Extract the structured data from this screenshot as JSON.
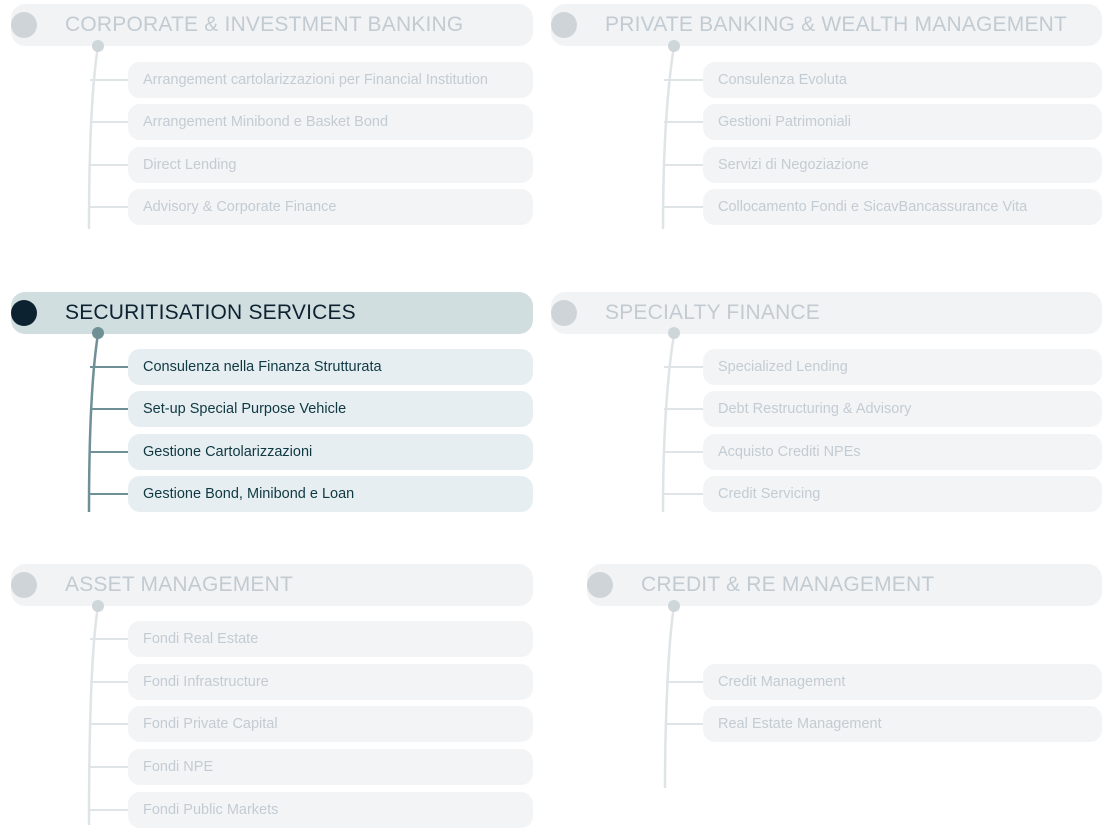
{
  "groups": [
    {
      "title": "CORPORATE & INVESTMENT BANKING",
      "active": false,
      "items": [
        "Arrangement cartolarizzazioni per Financial Institution",
        "Arrangement Minibond e Basket Bond",
        "Direct Lending",
        "Advisory & Corporate Finance"
      ]
    },
    {
      "title": "PRIVATE BANKING & WEALTH MANAGEMENT",
      "active": false,
      "items": [
        "Consulenza Evoluta",
        "Gestioni Patrimoniali",
        "Servizi di Negoziazione",
        "Collocamento Fondi e SicavBancassurance Vita"
      ]
    },
    {
      "title": "SECURITISATION SERVICES",
      "active": true,
      "items": [
        "Consulenza nella Finanza Strutturata",
        "Set-up Special Purpose Vehicle",
        "Gestione Cartolarizzazioni",
        "Gestione Bond, Minibond e Loan"
      ]
    },
    {
      "title": "SPECIALTY FINANCE",
      "active": false,
      "items": [
        "Specialized Lending",
        "Debt Restructuring & Advisory",
        "Acquisto Crediti NPEs",
        "Credit Servicing"
      ]
    },
    {
      "title": "ASSET MANAGEMENT",
      "active": false,
      "items": [
        "Fondi Real Estate",
        "Fondi Infrastructure",
        "Fondi Private Capital",
        "Fondi NPE",
        "Fondi Public Markets"
      ]
    },
    {
      "title": "CREDIT & RE MANAGEMENT",
      "active": false,
      "items": [
        "Credit Management",
        "Real Estate Management"
      ]
    }
  ],
  "colors": {
    "active_dot": "#0d2231",
    "active_header_bg": "#d1dedf",
    "active_text": "#0f3942",
    "connector_active": "#6f9096"
  }
}
